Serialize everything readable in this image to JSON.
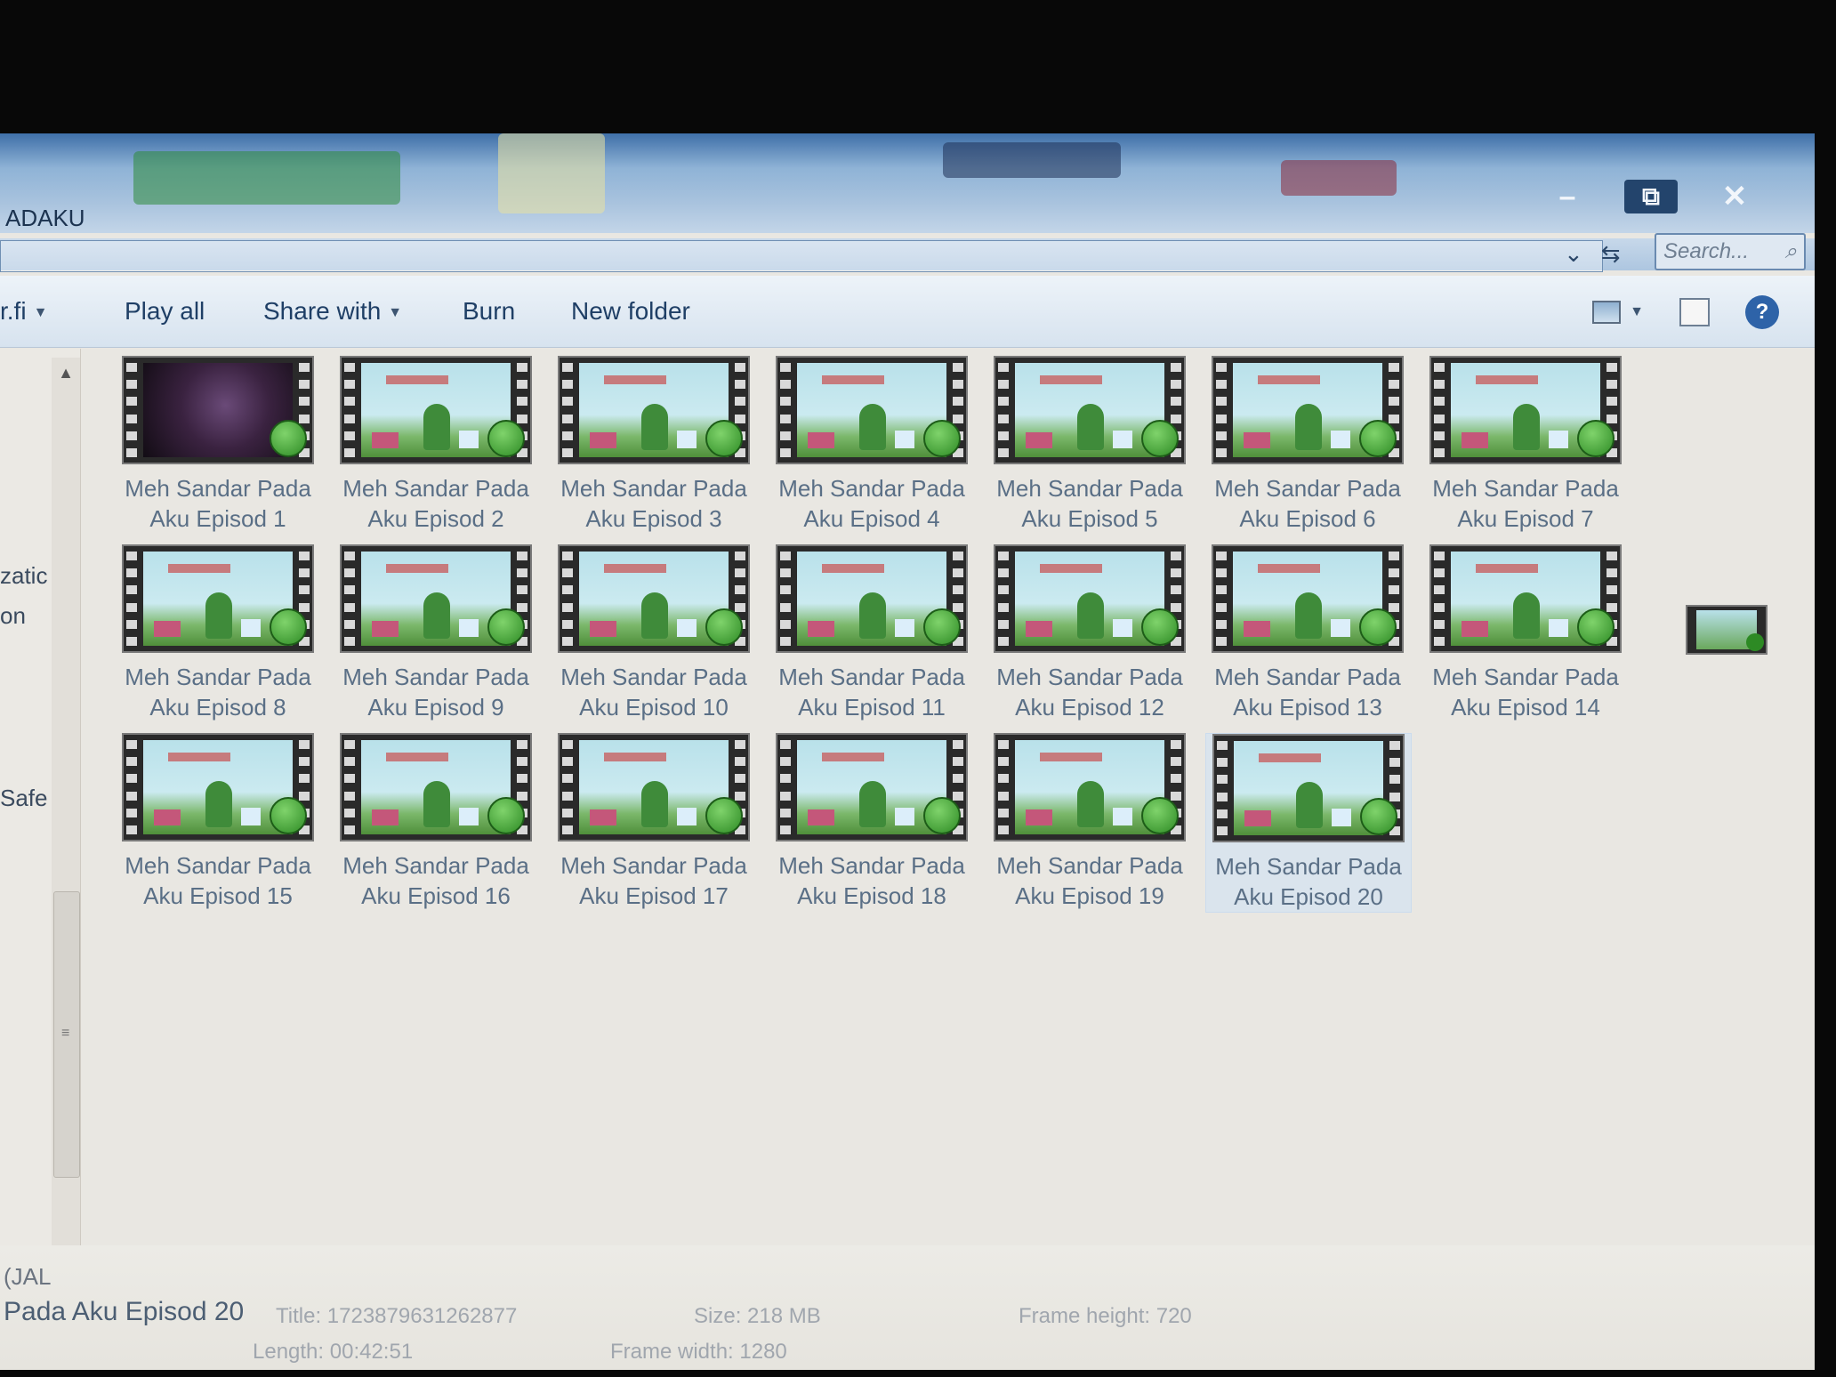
{
  "window": {
    "title": "ADAKU",
    "search_placeholder": "Search...",
    "controls": {
      "minimize": "–",
      "maximize": "⧉",
      "close": "✕"
    }
  },
  "toolbar": {
    "organize": "r.fi",
    "play_all": "Play all",
    "share_with": "Share with",
    "burn": "Burn",
    "new_folder": "New folder"
  },
  "nav": {
    "label_1": "zatic",
    "label_2": "on",
    "label_3": "Safe"
  },
  "files": [
    {
      "line1": "Meh Sandar Pada",
      "line2": "Aku Episod 1"
    },
    {
      "line1": "Meh Sandar Pada",
      "line2": "Aku Episod 2"
    },
    {
      "line1": "Meh Sandar Pada",
      "line2": "Aku Episod 3"
    },
    {
      "line1": "Meh Sandar Pada",
      "line2": "Aku Episod 4"
    },
    {
      "line1": "Meh Sandar Pada",
      "line2": "Aku Episod 5"
    },
    {
      "line1": "Meh Sandar Pada",
      "line2": "Aku Episod 6"
    },
    {
      "line1": "Meh Sandar Pada",
      "line2": "Aku Episod 7"
    },
    {
      "line1": "Meh Sandar Pada",
      "line2": "Aku Episod 8"
    },
    {
      "line1": "Meh Sandar Pada",
      "line2": "Aku Episod 9"
    },
    {
      "line1": "Meh Sandar Pada",
      "line2": "Aku Episod 10"
    },
    {
      "line1": "Meh Sandar Pada",
      "line2": "Aku Episod 11"
    },
    {
      "line1": "Meh Sandar Pada",
      "line2": "Aku Episod 12"
    },
    {
      "line1": "Meh Sandar Pada",
      "line2": "Aku Episod 13"
    },
    {
      "line1": "Meh Sandar Pada",
      "line2": "Aku Episod 14"
    },
    {
      "line1": "Meh Sandar Pada",
      "line2": "Aku Episod 15"
    },
    {
      "line1": "Meh Sandar Pada",
      "line2": "Aku Episod 16"
    },
    {
      "line1": "Meh Sandar Pada",
      "line2": "Aku Episod 17"
    },
    {
      "line1": "Meh Sandar Pada",
      "line2": "Aku Episod 18"
    },
    {
      "line1": "Meh Sandar Pada",
      "line2": "Aku Episod 19"
    },
    {
      "line1": "Meh Sandar Pada",
      "line2": "Aku Episod 20"
    }
  ],
  "details": {
    "drive": "(JAL",
    "name": "Pada Aku Episod 20",
    "title": "Title: 1723879631262877",
    "size": "Size: 218 MB",
    "frame_height": "Frame height: 720",
    "length": "Length: 00:42:51",
    "frame_width": "Frame width: 1280"
  }
}
